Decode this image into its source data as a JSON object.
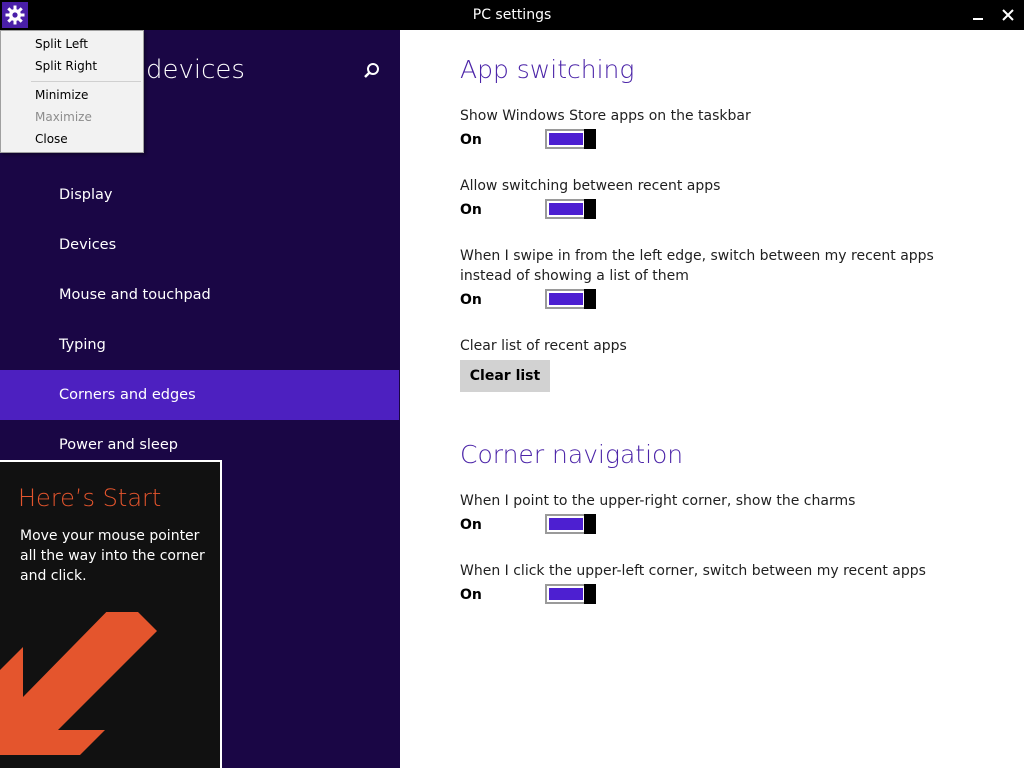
{
  "window": {
    "title": "PC settings",
    "icon": "gear-icon",
    "controls": [
      "minimize-icon",
      "close-icon"
    ]
  },
  "context_menu": {
    "items": [
      {
        "label": "Split Left",
        "enabled": true
      },
      {
        "label": "Split Right",
        "enabled": true
      },
      {
        "label": "Minimize",
        "enabled": true
      },
      {
        "label": "Maximize",
        "enabled": false
      },
      {
        "label": "Close",
        "enabled": true
      }
    ]
  },
  "sidebar": {
    "title": "devices",
    "search_icon": "search-icon",
    "items": [
      {
        "label": "Display",
        "selected": false
      },
      {
        "label": "Devices",
        "selected": false
      },
      {
        "label": "Mouse and touchpad",
        "selected": false
      },
      {
        "label": "Typing",
        "selected": false
      },
      {
        "label": "Corners and edges",
        "selected": true
      },
      {
        "label": "Power and sleep",
        "selected": false
      }
    ]
  },
  "tip": {
    "title": "Here’s Start",
    "body": "Move your mouse pointer all the way into the corner and click.",
    "arrow_icon": "arrow-down-left-icon"
  },
  "content": {
    "section1_title": "App switching",
    "settings1": [
      {
        "label": "Show Windows Store apps on the taskbar",
        "state": "On",
        "value": true
      },
      {
        "label": "Allow switching between recent apps",
        "state": "On",
        "value": true
      },
      {
        "label": "When I swipe in from the left edge, switch between my recent apps instead of showing a list of them",
        "state": "On",
        "value": true
      }
    ],
    "clear_list": {
      "label": "Clear list of recent apps",
      "button": "Clear list"
    },
    "section2_title": "Corner navigation",
    "settings2": [
      {
        "label": "When I point to the upper-right corner, show the charms",
        "state": "On",
        "value": true
      },
      {
        "label": "When I click the upper-left corner, switch between my recent apps",
        "state": "On",
        "value": true
      }
    ]
  },
  "colors": {
    "sidebar_bg": "#1a0645",
    "selected_bg": "#4d20c0",
    "accent": "#4b24a8",
    "toggle_on": "#4d1fd1",
    "tip_title": "#e4552d",
    "tip_arrow": "#e4552d"
  }
}
